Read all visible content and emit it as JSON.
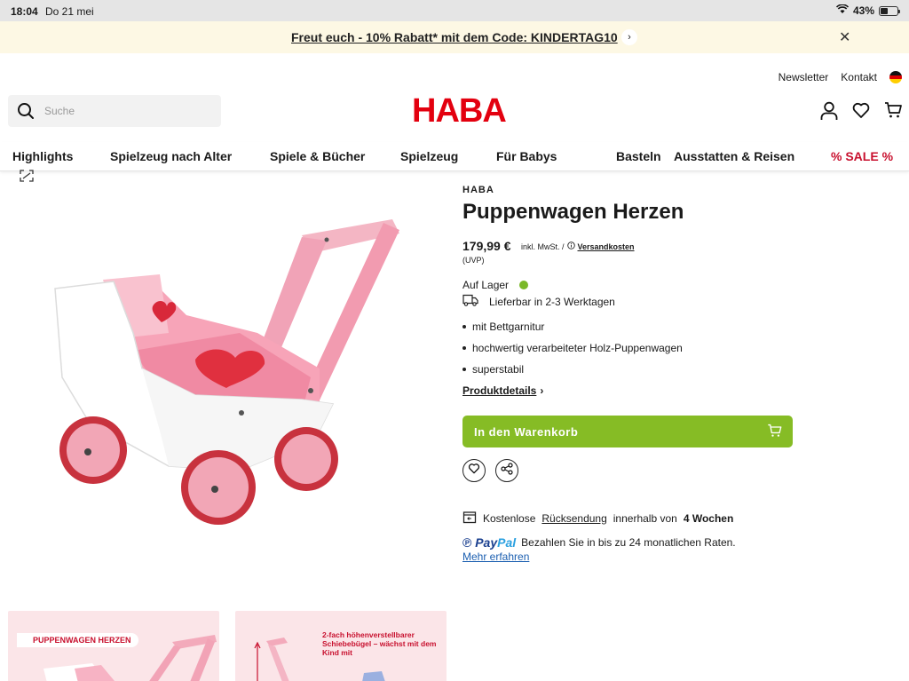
{
  "status_bar": {
    "time": "18:04",
    "date": "Do 21 mei",
    "battery": "43%",
    "battery_level": 0.43
  },
  "promo": {
    "text": "Freut euch - 10% Rabatt* mit dem Code: KINDERTAG10"
  },
  "top_links": {
    "newsletter": "Newsletter",
    "kontakt": "Kontakt"
  },
  "search": {
    "placeholder": "Suche"
  },
  "logo": "HABA",
  "nav": [
    "Highlights",
    "Spielzeug nach Alter",
    "Spiele & Bücher",
    "Spielzeug",
    "Für Babys",
    "Basteln",
    "Ausstatten & Reisen",
    "% SALE %"
  ],
  "product": {
    "brand": "HABA",
    "title": "Puppenwagen Herzen",
    "price": "179,99 €",
    "tax_note": "inkl. MwSt. /",
    "shipping_link": "Versandkosten",
    "uvp": "(UVP)",
    "stock": "Auf Lager",
    "delivery": "Lieferbar in 2-3 Werktagen",
    "features": [
      "mit Bettgarnitur",
      "hochwertig verarbeiteter Holz-Puppenwagen",
      "superstabil"
    ],
    "details_link": "Produktdetails",
    "add_to_cart": "In den Warenkorb"
  },
  "returns": {
    "prefix": "Kostenlose",
    "link": "Rücksendung",
    "middle": "innerhalb von",
    "bold": "4 Wochen"
  },
  "paypal": {
    "brand_pay": "Pay",
    "brand_pal": "Pal",
    "text": "Bezahlen Sie in bis zu 24 monatlichen Raten.",
    "more": "Mehr erfahren"
  },
  "thumbnails": {
    "first_tag": "PUPPENWAGEN HERZEN",
    "second_text": "2-fach höhenverstellbarer Schiebebügel – wächst mit dem Kind mit"
  },
  "colors": {
    "accent_green": "#86bc25",
    "brand_red": "#e3000f",
    "sale_red": "#c8102e",
    "promo_bg": "#fdf8e4"
  }
}
